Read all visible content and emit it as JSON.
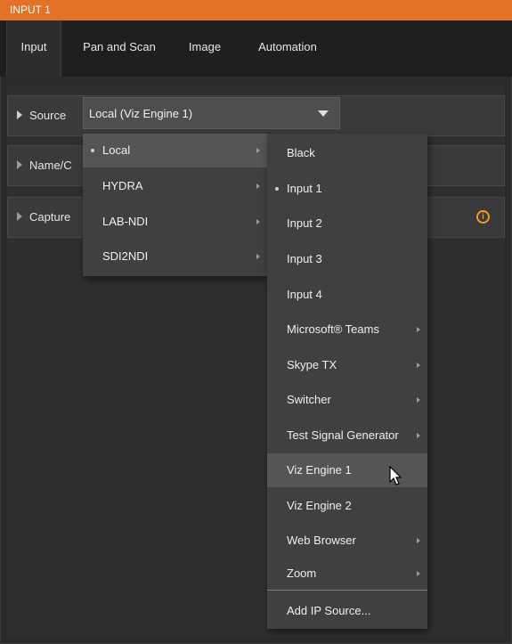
{
  "window": {
    "title": "INPUT 1"
  },
  "tabs": [
    {
      "label": "Input"
    },
    {
      "label": "Pan and Scan"
    },
    {
      "label": "Image"
    },
    {
      "label": "Automation"
    }
  ],
  "sections": [
    {
      "label": "Source",
      "value": "Local (Viz Engine 1)"
    },
    {
      "label": "Name/C"
    },
    {
      "label": "Capture"
    }
  ],
  "icons": {
    "info": "i"
  },
  "menu_level1": {
    "items": [
      {
        "label": "Local",
        "selected": true,
        "submenu": true
      },
      {
        "label": "HYDRA",
        "submenu": true
      },
      {
        "label": "LAB-NDI",
        "submenu": true
      },
      {
        "label": "SDI2NDI",
        "submenu": true
      }
    ]
  },
  "menu_level2": {
    "items": [
      {
        "label": "Black"
      },
      {
        "label": "Input 1",
        "selected": true
      },
      {
        "label": "Input 2"
      },
      {
        "label": "Input 3"
      },
      {
        "label": "Input 4"
      },
      {
        "label": "Microsoft® Teams",
        "submenu": true
      },
      {
        "label": "Skype TX",
        "submenu": true
      },
      {
        "label": "Switcher",
        "submenu": true
      },
      {
        "label": "Test Signal Generator",
        "submenu": true
      },
      {
        "label": "Viz Engine 1",
        "hovered": true
      },
      {
        "label": "Viz Engine 2"
      },
      {
        "label": "Web Browser",
        "submenu": true
      },
      {
        "label": "Zoom",
        "submenu": true
      },
      {
        "label": "Add IP Source..."
      }
    ]
  },
  "colors": {
    "accent": "#e37226",
    "info": "#f39c1e"
  }
}
